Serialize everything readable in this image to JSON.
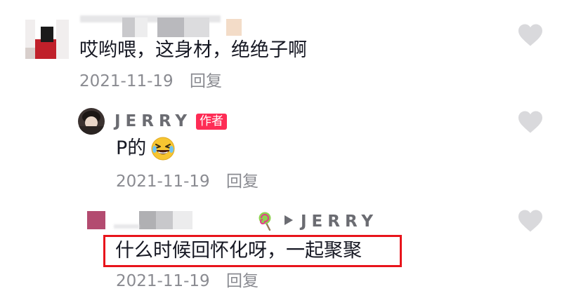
{
  "comments": [
    {
      "text": "哎哟喂，这身材，绝绝子啊",
      "date": "2021-11-19",
      "reply_label": "回复"
    },
    {
      "author": "JERRY",
      "author_badge": "作者",
      "text": "P的",
      "emoji": "laughing-face-emoji",
      "date": "2021-11-19",
      "reply_label": "回复"
    },
    {
      "reply_to": "JERRY",
      "text": "什么时候回怀化呀，一起聚聚",
      "date": "2021-11-19",
      "reply_label": "回复"
    }
  ],
  "colors": {
    "heart": "#d9d9dc",
    "badge": "#fe2c55",
    "highlight": "#e8141b"
  }
}
